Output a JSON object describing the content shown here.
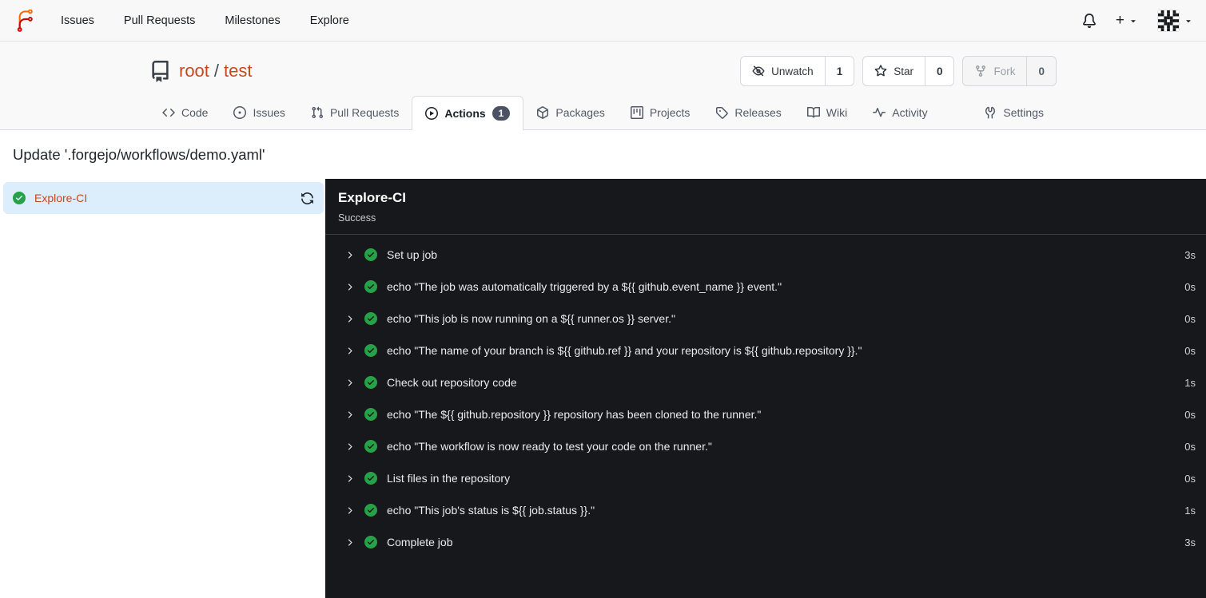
{
  "navbar": {
    "items": [
      "Issues",
      "Pull Requests",
      "Milestones",
      "Explore"
    ],
    "add_label": "+"
  },
  "repo": {
    "owner": "root",
    "separator": "/",
    "name": "test",
    "buttons": [
      {
        "label": "Unwatch",
        "count": "1",
        "disabled": false
      },
      {
        "label": "Star",
        "count": "0",
        "disabled": false
      },
      {
        "label": "Fork",
        "count": "0",
        "disabled": true
      }
    ]
  },
  "tabs": [
    {
      "label": "Code"
    },
    {
      "label": "Issues"
    },
    {
      "label": "Pull Requests"
    },
    {
      "label": "Actions",
      "badge": "1",
      "active": true
    },
    {
      "label": "Packages"
    },
    {
      "label": "Projects"
    },
    {
      "label": "Releases"
    },
    {
      "label": "Wiki"
    },
    {
      "label": "Activity"
    },
    {
      "label": "Settings"
    }
  ],
  "run": {
    "title": "Update '.forgejo/workflows/demo.yaml'"
  },
  "sidebar": {
    "job_label": "Explore-CI",
    "job_status": "success"
  },
  "panel": {
    "title": "Explore-CI",
    "status": "Success",
    "steps": [
      {
        "name": "Set up job",
        "duration": "3s"
      },
      {
        "name": "echo \"The job was automatically triggered by a ${{ github.event_name }} event.\"",
        "duration": "0s"
      },
      {
        "name": "echo \"This job is now running on a ${{ runner.os }} server.\"",
        "duration": "0s"
      },
      {
        "name": "echo \"The name of your branch is ${{ github.ref }} and your repository is ${{ github.repository }}.\"",
        "duration": "0s"
      },
      {
        "name": "Check out repository code",
        "duration": "1s"
      },
      {
        "name": "echo \"The ${{ github.repository }} repository has been cloned to the runner.\"",
        "duration": "0s"
      },
      {
        "name": "echo \"The workflow is now ready to test your code on the runner.\"",
        "duration": "0s"
      },
      {
        "name": "List files in the repository",
        "duration": "0s"
      },
      {
        "name": "echo \"This job's status is ${{ job.status }}.\"",
        "duration": "1s"
      },
      {
        "name": "Complete job",
        "duration": "3s"
      }
    ]
  },
  "colors": {
    "accent_link": "#c8481f",
    "success_green": "#26a148",
    "panel_bg": "#17181b",
    "selected_job_bg": "#dceefb",
    "badge_bg": "#4a5263",
    "header_bg": "#f8f8f8"
  },
  "icons": {
    "forgejo-logo": "curved branch glyph (orange/red)",
    "bell-icon": "🔔",
    "plus-icon": "+",
    "caret-down-icon": "▾",
    "avatar-identicon": "pixel identicon",
    "repo-book-icon": "📘",
    "eye-slash-icon": "eye with slash",
    "star-icon": "☆",
    "fork-icon": "git fork",
    "code-icon": "<>",
    "issue-icon": "⊙",
    "pull-request-icon": "git pull request",
    "play-circle-icon": "▶ in circle",
    "package-icon": "cube",
    "project-icon": "board with bars",
    "tag-icon": "tag",
    "wiki-icon": "open book",
    "pulse-icon": "pulse line",
    "wrench-icon": "tools",
    "refresh-icon": "⟳",
    "chevron-right-icon": "›",
    "check-circle-icon": "✔ in green circle"
  }
}
